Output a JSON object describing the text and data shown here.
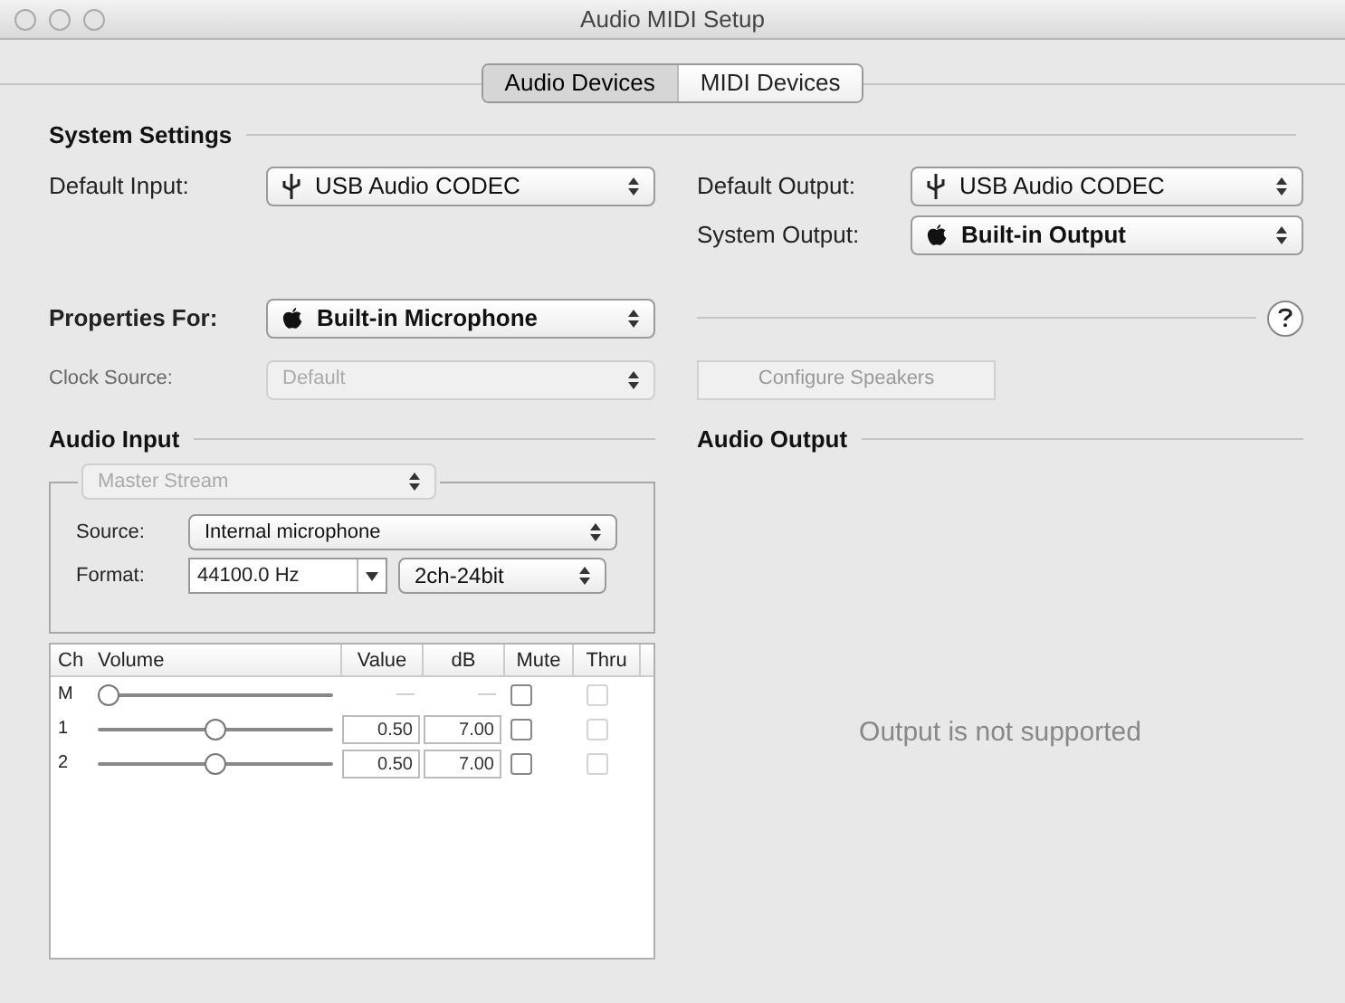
{
  "window": {
    "title": "Audio MIDI Setup"
  },
  "tabs": [
    {
      "label": "Audio Devices",
      "selected": true
    },
    {
      "label": "MIDI Devices",
      "selected": false
    }
  ],
  "system_settings": {
    "heading": "System Settings",
    "default_input": {
      "label": "Default Input:",
      "value": "USB Audio CODEC",
      "kind": "usb"
    },
    "default_output": {
      "label": "Default Output:",
      "value": "USB Audio CODEC",
      "kind": "usb"
    },
    "system_output": {
      "label": "System Output:",
      "value": "Built-in Output",
      "kind": "apple"
    }
  },
  "properties_for": {
    "label": "Properties For:",
    "value": "Built-in Microphone",
    "kind": "apple"
  },
  "clock_source": {
    "label": "Clock Source:",
    "value": "Default",
    "disabled": true
  },
  "configure_speakers": {
    "label": "Configure Speakers",
    "disabled": true
  },
  "audio_input": {
    "heading": "Audio Input",
    "stream": {
      "value": "Master Stream",
      "disabled": true
    },
    "source": {
      "label": "Source:",
      "value": "Internal microphone"
    },
    "format": {
      "label": "Format:",
      "rate": "44100.0 Hz",
      "channels": "2ch-24bit"
    },
    "table": {
      "columns": [
        "Ch",
        "Volume",
        "Value",
        "dB",
        "Mute",
        "Thru"
      ],
      "rows": [
        {
          "ch": "M",
          "level": 0,
          "value": "—",
          "db": "—",
          "disabled": true,
          "mute": false,
          "thru": {
            "checked": false,
            "disabled": true
          }
        },
        {
          "ch": "1",
          "level": 0.5,
          "value": "0.50",
          "db": "7.00",
          "disabled": false,
          "mute": false,
          "thru": {
            "checked": false,
            "disabled": true
          }
        },
        {
          "ch": "2",
          "level": 0.5,
          "value": "0.50",
          "db": "7.00",
          "disabled": false,
          "mute": false,
          "thru": {
            "checked": false,
            "disabled": true
          }
        }
      ]
    }
  },
  "audio_output": {
    "heading": "Audio Output",
    "message": "Output is not supported"
  }
}
